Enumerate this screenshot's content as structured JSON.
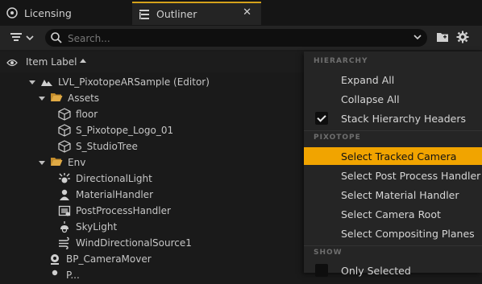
{
  "tabs": [
    {
      "label": "Licensing",
      "active": false
    },
    {
      "label": "Outliner",
      "active": true
    }
  ],
  "tab_close": "✕",
  "toolbar": {
    "search_placeholder": "Search..."
  },
  "header": {
    "item_label": "Item Label"
  },
  "tree": [
    {
      "label": "LVL_PixotopeARSample (Editor)",
      "icon": "level-icon",
      "expanded": true
    },
    {
      "label": "Assets",
      "icon": "folder-open-icon",
      "expanded": true
    },
    {
      "label": "floor",
      "icon": "static-mesh-icon"
    },
    {
      "label": "S_Pixotope_Logo_01",
      "icon": "static-mesh-icon"
    },
    {
      "label": "S_StudioTree",
      "icon": "static-mesh-icon"
    },
    {
      "label": "Env",
      "icon": "folder-open-icon",
      "expanded": true
    },
    {
      "label": "DirectionalLight",
      "icon": "directional-light-icon"
    },
    {
      "label": "MaterialHandler",
      "icon": "actor-icon"
    },
    {
      "label": "PostProcessHandler",
      "icon": "post-process-icon"
    },
    {
      "label": "SkyLight",
      "icon": "skylight-icon"
    },
    {
      "label": "WindDirectionalSource1",
      "icon": "wind-icon"
    },
    {
      "label": "BP_CameraMover",
      "icon": "camera-mover-icon"
    },
    {
      "label": "P..."
    }
  ],
  "menu": {
    "sections": {
      "hierarchy": "HIERARCHY",
      "pixotope": "PIXOTOPE",
      "show": "SHOW"
    },
    "hierarchy_items": [
      {
        "label": "Expand All"
      },
      {
        "label": "Collapse All"
      },
      {
        "label": "Stack Hierarchy Headers",
        "checked": true
      }
    ],
    "pixotope_items": [
      {
        "label": "Select Tracked Camera",
        "highlighted": true
      },
      {
        "label": "Select Post Process Handler"
      },
      {
        "label": "Select Material Handler"
      },
      {
        "label": "Select Camera Root"
      },
      {
        "label": "Select Compositing Planes"
      }
    ],
    "show_items": [
      {
        "label": "Only Selected",
        "checked": false
      }
    ]
  },
  "colors": {
    "accent": "#f1a400",
    "tab_accent": "#d5a21b",
    "folder": "#d8a23a"
  }
}
